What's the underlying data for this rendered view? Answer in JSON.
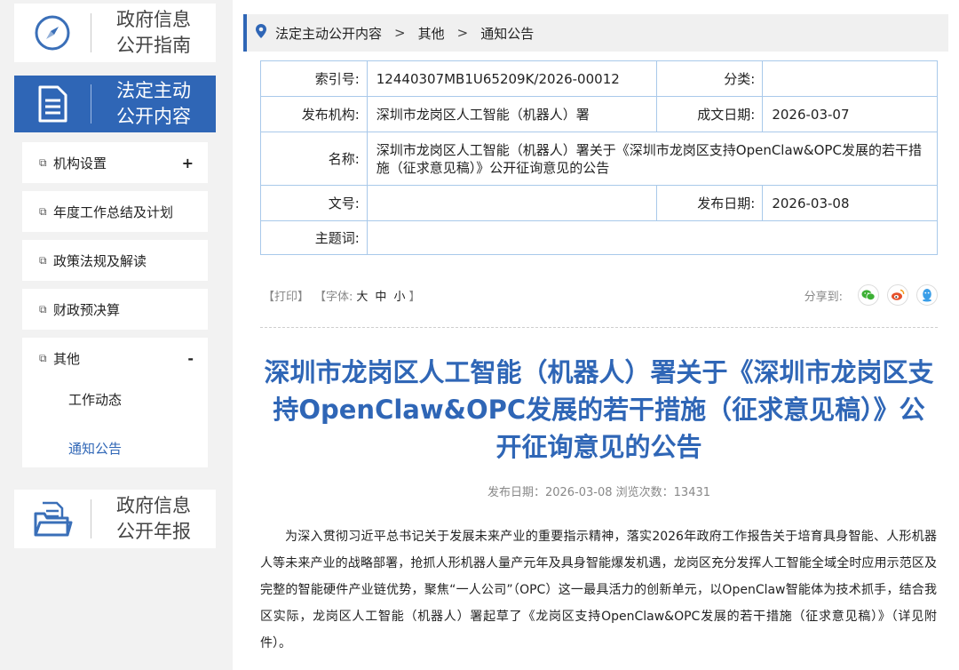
{
  "sidebar": {
    "guide": {
      "line1": "政府信息",
      "line2": "公开指南"
    },
    "active": {
      "line1": "法定主动",
      "line2": "公开内容"
    },
    "menu": [
      {
        "label": "机构设置",
        "toggle": "+"
      },
      {
        "label": "年度工作总结及计划"
      },
      {
        "label": "政策法规及解读"
      },
      {
        "label": "财政预决算"
      },
      {
        "label": "其他",
        "toggle": "-"
      }
    ],
    "submenu": [
      {
        "label": "工作动态"
      },
      {
        "label": "通知公告"
      }
    ],
    "annual": {
      "line1": "政府信息",
      "line2": "公开年报"
    }
  },
  "breadcrumb": {
    "items": [
      "法定主动公开内容",
      "其他",
      "通知公告"
    ],
    "separator": ">"
  },
  "meta": {
    "index_label": "索引号:",
    "index_value": "12440307MB1U65209K/2026-00012",
    "category_label": "分类:",
    "category_value": "",
    "publisher_label": "发布机构:",
    "publisher_value": "深圳市龙岗区人工智能（机器人）署",
    "created_label": "成文日期:",
    "created_value": "2026-03-07",
    "name_label": "名称:",
    "name_value": "深圳市龙岗区人工智能（机器人）署关于《深圳市龙岗区支持OpenClaw&OPC发展的若干措施（征求意见稿）》公开征询意见的公告",
    "docno_label": "文号:",
    "docno_value": "",
    "pubdate_label": "发布日期:",
    "pubdate_value": "2026-03-08",
    "subject_label": "主题词:",
    "subject_value": ""
  },
  "tools": {
    "print": "【打印】",
    "font_prefix": "【字体:",
    "font_large": "大",
    "font_medium": "中",
    "font_small": "小",
    "font_suffix": "】",
    "share_label": "分享到:",
    "share_icons": [
      "wechat-icon",
      "weibo-icon",
      "qq-icon"
    ]
  },
  "article": {
    "title": "深圳市龙岗区人工智能（机器人）署关于《深圳市龙岗区支持OpenClaw&OPC发展的若干措施（征求意见稿）》公开征询意见的公告",
    "pubinfo": "发布日期：2026-03-08   浏览次数：13431",
    "body": "为深入贯彻习近平总书记关于发展未来产业的重要指示精神，落实2026年政府工作报告关于培育具身智能、人形机器人等未来产业的战略部署，抢抓人形机器人量产元年及具身智能爆发机遇，龙岗区充分发挥人工智能全域全时应用示范区及完整的智能硬件产业链优势，聚焦“一人公司”（OPC）这一最具活力的创新单元，以OpenClaw智能体为技术抓手，结合我区实际，龙岗区人工智能（机器人）署起草了《龙岗区支持OpenClaw&OPC发展的若干措施（征求意见稿）》（详见附件）。"
  },
  "colors": {
    "accent": "#2f66b6",
    "table_border": "#a9c9ea",
    "wechat": "#3cb034",
    "weibo": "#e6512b",
    "qq": "#3a9ee8"
  }
}
